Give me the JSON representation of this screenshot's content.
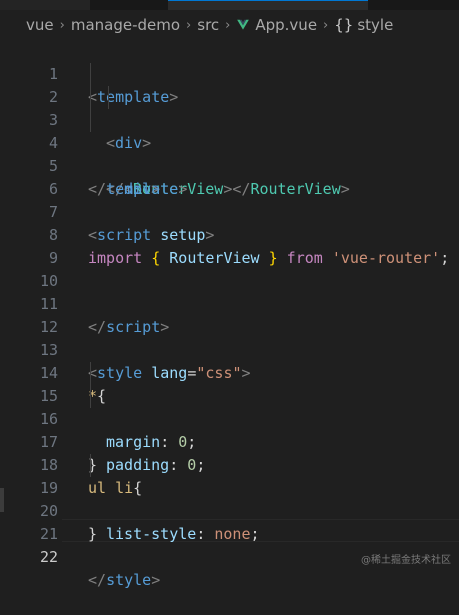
{
  "breadcrumb": {
    "items": [
      "vue",
      "manage-demo",
      "src",
      "App.vue",
      "style"
    ],
    "separator": ">",
    "file_icon": "vue-file-icon",
    "symbol_icon": "braces-icon"
  },
  "editor": {
    "current_line": "22",
    "line_numbers": [
      "1",
      "2",
      "3",
      "4",
      "5",
      "6",
      "7",
      "8",
      "9",
      "10",
      "11",
      "12",
      "13",
      "14",
      "15",
      "16",
      "17",
      "18",
      "19",
      "20",
      "21",
      "22"
    ]
  },
  "code": {
    "l1": [
      "<",
      "template",
      ">"
    ],
    "l2": [
      "<",
      "div",
      ">"
    ],
    "l3": [
      "<",
      "RouterView",
      "></",
      "RouterView",
      ">"
    ],
    "l4": [
      "</",
      "div",
      ">"
    ],
    "l5": [
      "</",
      "template",
      ">"
    ],
    "l7": [
      "<",
      "script",
      " ",
      "setup",
      ">"
    ],
    "l8": [
      "import",
      " ",
      "{",
      " RouterView ",
      "}",
      " from ",
      "'vue-router'",
      ";"
    ],
    "l11": [
      "</",
      "script",
      ">"
    ],
    "l13": [
      "<",
      "style",
      " ",
      "lang",
      "=",
      "\"css\"",
      ">"
    ],
    "l14": [
      "*",
      "{"
    ],
    "l15": [
      "margin",
      ": ",
      "0",
      ";"
    ],
    "l16": [
      "padding",
      ": ",
      "0",
      ";"
    ],
    "l17": [
      "}"
    ],
    "l18": [
      "ul li",
      "{"
    ],
    "l19": [
      "list-style",
      ": ",
      "none",
      ";"
    ],
    "l20": [
      "}"
    ],
    "l22": [
      "</",
      "style",
      ">"
    ]
  },
  "watermark": "@稀土掘金技术社区",
  "colors": {
    "background": "#1f1f1f",
    "tag": "#569cd6",
    "component": "#4ec9b0",
    "keyword": "#c586c0",
    "string": "#ce9178",
    "number": "#b5cea8",
    "selector": "#d7ba7d",
    "property": "#9cdcfe",
    "brace": "#ffd700"
  }
}
